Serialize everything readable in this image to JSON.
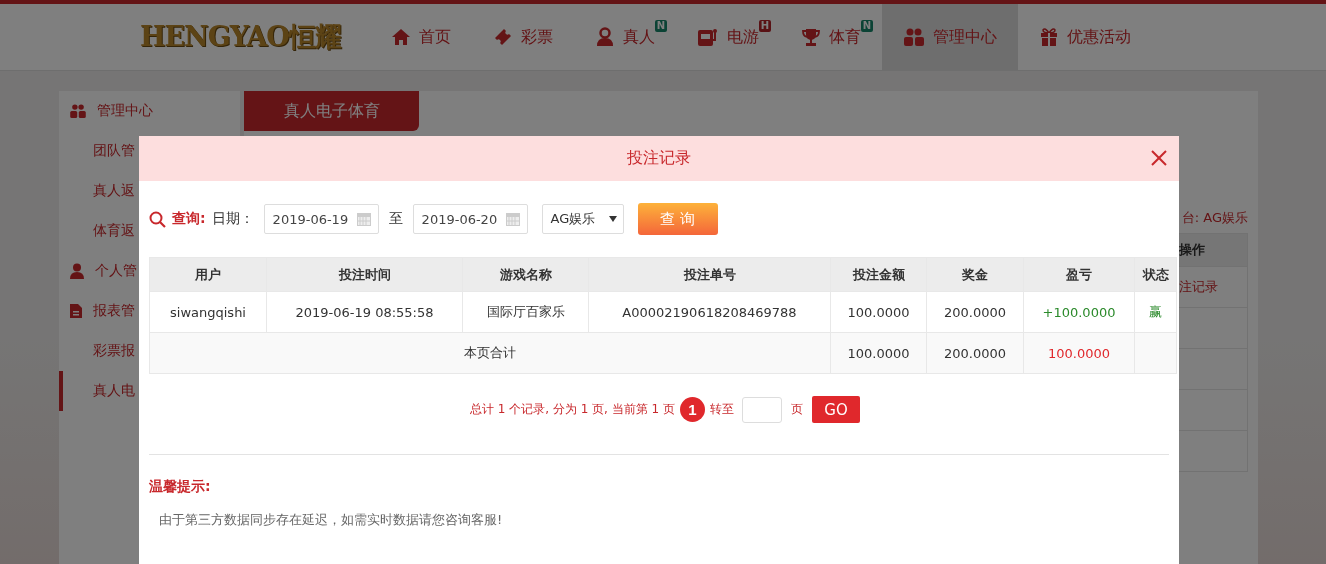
{
  "header": {
    "logo": "HENGYAO恒耀",
    "nav": [
      {
        "label": "首页",
        "selected": false
      },
      {
        "label": "彩票",
        "selected": false
      },
      {
        "label": "真人",
        "selected": false,
        "badge": {
          "text": "N",
          "kind": "new"
        }
      },
      {
        "label": "电游",
        "selected": false,
        "badge": {
          "text": "H",
          "kind": "hot"
        }
      },
      {
        "label": "体育",
        "selected": false,
        "badge": {
          "text": "N",
          "kind": "new"
        }
      },
      {
        "label": "管理中心",
        "selected": true
      },
      {
        "label": "优惠活动",
        "selected": false
      }
    ]
  },
  "sidebar": {
    "items": [
      {
        "label": "管理中心",
        "kind": "section",
        "selected": false
      },
      {
        "label": "团队管",
        "kind": "link",
        "selected": false
      },
      {
        "label": "真人返",
        "kind": "link",
        "selected": false
      },
      {
        "label": "体育返",
        "kind": "link",
        "selected": false
      },
      {
        "label": "个人管",
        "kind": "section",
        "selected": false
      },
      {
        "label": "报表管",
        "kind": "section",
        "selected": false
      },
      {
        "label": "彩票报",
        "kind": "link",
        "selected": false
      },
      {
        "label": "真人电",
        "kind": "link",
        "selected": true
      }
    ]
  },
  "content": {
    "tab": "真人电子体育",
    "platform": "台: AG娱乐",
    "column_header": "操作",
    "link": "注记录"
  },
  "modal": {
    "title": "投注记录",
    "filter": {
      "label": "查询:",
      "date_label": "日期：",
      "start": "2019-06-19",
      "to": "至",
      "end": "2019-06-20",
      "platform": "AG娱乐",
      "button": "查 询"
    },
    "table": {
      "columns": [
        "用户",
        "投注时间",
        "游戏名称",
        "投注单号",
        "投注金额",
        "奖金",
        "盈亏",
        "状态"
      ],
      "rows": [
        {
          "cells": [
            "siwangqishi",
            "2019-06-19 08:55:58",
            "国际厅百家乐",
            "A00002190618208469788",
            "100.0000",
            "200.0000",
            "+100.0000",
            "赢"
          ]
        }
      ],
      "total": {
        "label": "本页合计",
        "cells": [
          "100.0000",
          "200.0000",
          "100.0000"
        ]
      }
    },
    "pagination": {
      "summary": "总计 1 个记录, 分为 1 页, 当前第 1 页",
      "pages": [
        {
          "label": "1",
          "selected": true
        }
      ],
      "goto": "转至",
      "unit": "页",
      "button": "GO"
    },
    "notice": {
      "title": "温馨提示:",
      "text": "由于第三方数据同步存在延迟，如需实时数据请您咨询客服!"
    }
  }
}
